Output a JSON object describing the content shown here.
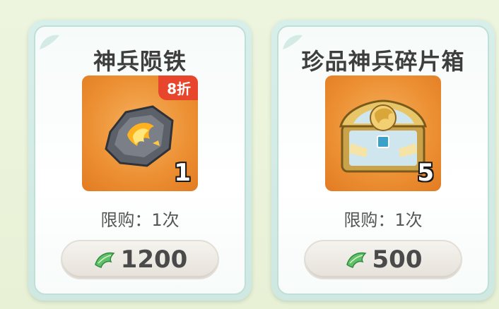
{
  "cards": [
    {
      "title": "神兵陨铁",
      "discount": "8折",
      "quantity": "1",
      "limit": "限购：1次",
      "price": "1200",
      "item_icon": "meteorite-ore-icon",
      "currency_icon": "jade-leaf-icon"
    },
    {
      "title": "珍品神兵碎片箱",
      "quantity": "5",
      "limit": "限购：1次",
      "price": "500",
      "item_icon": "golden-dragon-chest-icon",
      "currency_icon": "jade-leaf-icon"
    }
  ],
  "colors": {
    "discount_badge": "#e8452d",
    "item_bg": "#ec8f32",
    "card_border": "#bfe0d8"
  }
}
